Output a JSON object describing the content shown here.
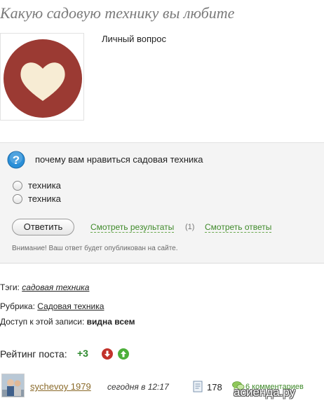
{
  "post": {
    "title": "Какую садовую технику вы любите",
    "personal_label": "Личный вопрос"
  },
  "poll": {
    "question": "почему вам нравиться садовая техника",
    "options": [
      "техника",
      "техника"
    ],
    "answer_button": "Ответить",
    "results_link": "Смотреть результаты",
    "results_count": "(1)",
    "answers_link": "Смотреть ответы",
    "warning": "Внимание! Ваш ответ будет опубликован на сайте."
  },
  "meta": {
    "tags_label": "Тэги:",
    "tag": "садовая техника",
    "rubric_label": "Рубрика:",
    "rubric": "Садовая техника",
    "access_label": "Доступ к этой записи:",
    "access_value": "видна всем"
  },
  "rating": {
    "label": "Рейтинг поста:",
    "value": "+3"
  },
  "footer": {
    "author": "sychevoy 1979",
    "date": "сегодня в 12:17",
    "views": "178",
    "comments": "6 комментариев"
  },
  "watermark": "асиенда.ру",
  "colors": {
    "heart_circle": "#9b3a33",
    "green_link": "#3f8a2a",
    "rating_green": "#2d8a2d",
    "title_gray": "#7a7a7a"
  },
  "icons": {
    "image": "heart-in-circle",
    "question": "question-mark",
    "vote_down": "arrow-down",
    "vote_up": "arrow-up",
    "views": "document",
    "comments": "speech-bubbles"
  }
}
